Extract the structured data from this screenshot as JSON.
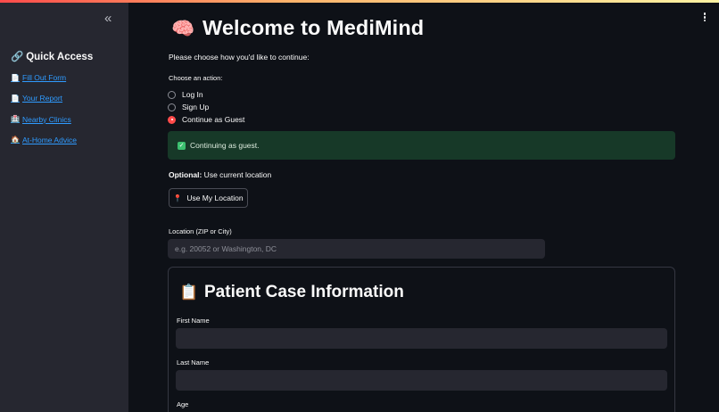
{
  "sidebar": {
    "collapse_icon": "«",
    "quick_access": {
      "icon": "🔗",
      "label": "Quick Access"
    },
    "links": [
      {
        "emoji": "📄",
        "label": "Fill Out Form"
      },
      {
        "emoji": "📄",
        "label": "Your Report"
      },
      {
        "emoji": "🏥",
        "label": "Nearby Clinics"
      },
      {
        "emoji": "🏠",
        "label": "At-Home Advice"
      }
    ]
  },
  "main": {
    "title": {
      "emoji": "🧠",
      "text": "Welcome to MediMind"
    },
    "prompt": "Please choose how you'd like to continue:",
    "radio": {
      "label": "Choose an action:",
      "options": [
        "Log In",
        "Sign Up",
        "Continue as Guest"
      ],
      "selected": "Continue as Guest"
    },
    "success": {
      "icon": "✓",
      "text": "Continuing as guest."
    },
    "optional": {
      "bold": "Optional:",
      "text": " Use current location"
    },
    "location_button": {
      "icon": "📍",
      "label": "Use My Location"
    },
    "location_field": {
      "label": "Location (ZIP or City)",
      "placeholder": "e.g. 20052 or Washington, DC",
      "value": ""
    },
    "card": {
      "title": {
        "emoji": "📋",
        "text": "Patient Case Information"
      },
      "fields": [
        {
          "label": "First Name",
          "value": ""
        },
        {
          "label": "Last Name",
          "value": ""
        },
        {
          "label": "Age",
          "value": ""
        }
      ]
    }
  },
  "colors": {
    "accent": "#ff4b4b",
    "link": "#2f9bff",
    "success_bg": "#173928",
    "sidebar_bg": "#262730",
    "page_bg": "#0e1117"
  }
}
